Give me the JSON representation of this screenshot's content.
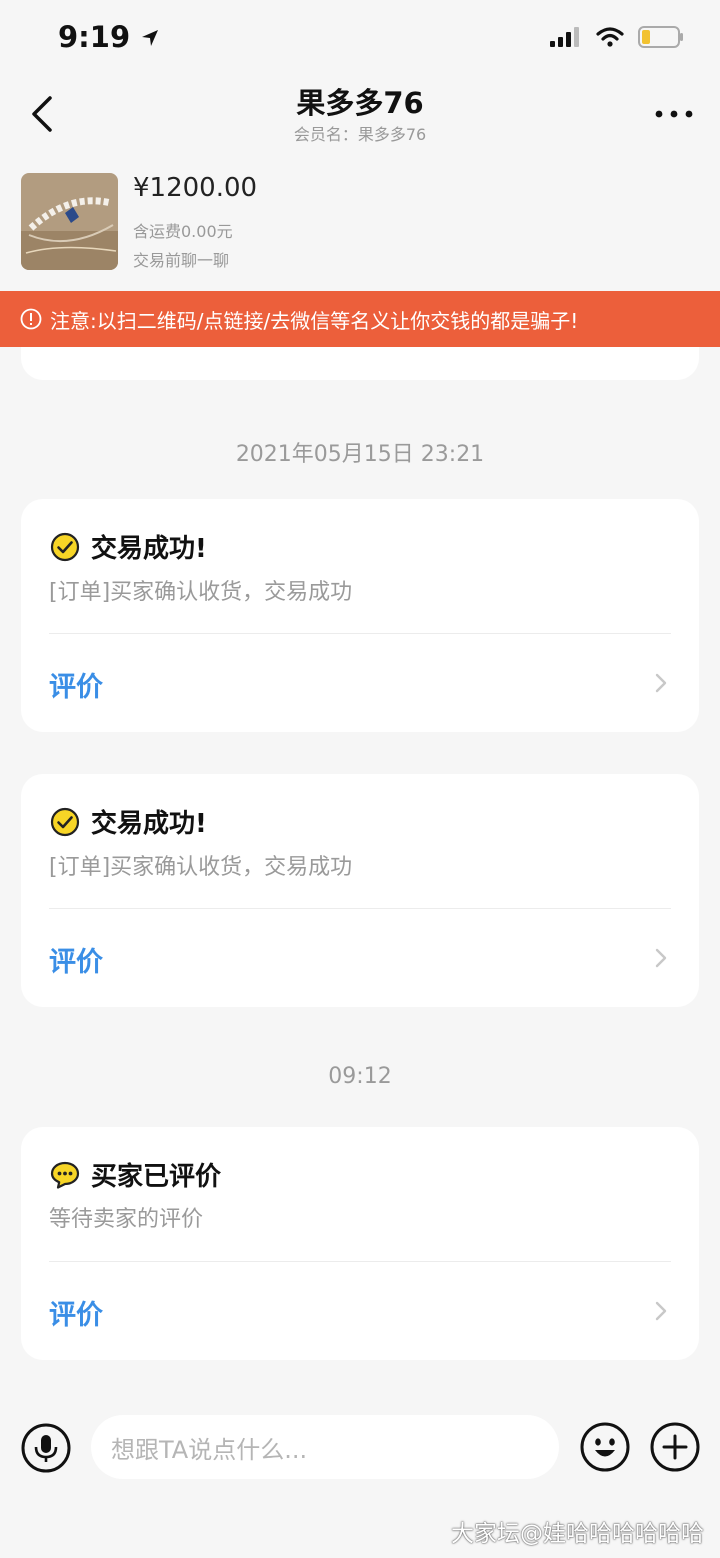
{
  "status_bar": {
    "time": "9:19"
  },
  "nav": {
    "title": "果多多76",
    "subtitle": "会员名：果多多76"
  },
  "product": {
    "price": "¥1200.00",
    "shipping": "含运费0.00元",
    "chat_hint": "交易前聊一聊"
  },
  "warning": {
    "text": "注意:以扫二维码/点链接/去微信等名义让你交钱的都是骗子!"
  },
  "messages": {
    "timestamp_1": "2021年05月15日  23:21",
    "card_1": {
      "title": "交易成功!",
      "desc": "[订单]买家确认收货，交易成功",
      "action": "评价"
    },
    "card_2": {
      "title": "交易成功!",
      "desc": "[订单]买家确认收货，交易成功",
      "action": "评价"
    },
    "timestamp_2": "09:12",
    "card_3": {
      "title": "买家已评价",
      "desc": "等待卖家的评价",
      "action": "评价"
    }
  },
  "input": {
    "placeholder": "想跟TA说点什么..."
  },
  "watermark": "大家坛@娃哈哈哈哈哈哈",
  "colors": {
    "warning_bg": "#ec5f3b",
    "action_blue": "#3a8ee6",
    "success_yellow": "#f7d526",
    "page_bg": "#f6f6f6"
  }
}
